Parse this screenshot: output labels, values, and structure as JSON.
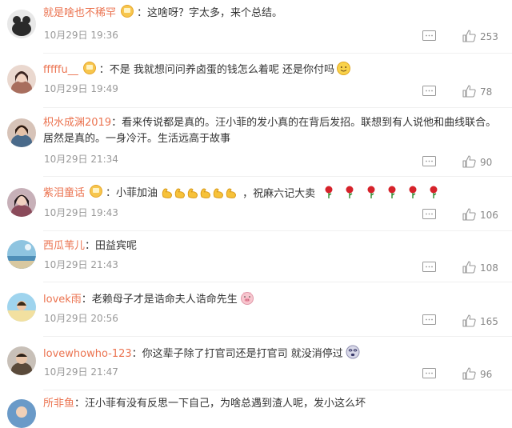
{
  "comments": [
    {
      "user": "就是啥也不稀罕",
      "vip": true,
      "text": "：这啥呀？字太多，来个总结。",
      "time": "10月29日 19:36",
      "likes": "253",
      "avatar_color": "#2a2a2a",
      "emoji": ""
    },
    {
      "user": "fffffu__",
      "vip": true,
      "text": "：不是 我就想问问养卤蛋的钱怎么着呢 还是你付吗",
      "time": "10月29日 19:49",
      "likes": "78",
      "avatar_color": "#c89a88",
      "emoji": "smile"
    },
    {
      "user": "枳水成渊2019",
      "vip": false,
      "text": "：看来传说都是真的。汪小菲的发小真的在背后发招。联想到有人说他和曲线联合。居然是真的。一身冷汗。生活远高于故事",
      "time": "10月29日 21:34",
      "likes": "90",
      "avatar_color": "#5a3a2e",
      "emoji": ""
    },
    {
      "user": "紫泪童话",
      "vip": true,
      "text": "：小菲加油",
      "time": "10月29日 19:43",
      "likes": "106",
      "avatar_color": "#8a4a5a",
      "emoji": "strong-roses"
    },
    {
      "user": "西瓜苇儿",
      "vip": false,
      "text": "：田益宾呢",
      "time": "10月29日 21:43",
      "likes": "108",
      "avatar_color": "#6aa8c8",
      "emoji": ""
    },
    {
      "user": "lovek雨",
      "vip": false,
      "text": "：老赖母子才是诰命夫人诰命先生",
      "time": "10月29日 20:56",
      "likes": "165",
      "avatar_color": "#78b8d8",
      "emoji": "pig"
    },
    {
      "user": "lovewhowho-123",
      "vip": false,
      "text": "：你这辈子除了打官司还是打官司 就没消停过",
      "time": "10月29日 21:47",
      "likes": "96",
      "avatar_color": "#7a6a5a",
      "emoji": "dizzy"
    },
    {
      "user": "所非鱼",
      "vip": false,
      "text": "：汪小菲有没有反思一下自己，为啥总遇到渣人呢，发小这么坏",
      "time": "",
      "likes": "",
      "avatar_color": "#4a7aa8",
      "emoji": ""
    }
  ],
  "icons": {
    "reply": "reply-icon",
    "like": "thumbs-up-icon",
    "vip": "vip-badge-icon"
  },
  "colors": {
    "username": "#eb7350",
    "meta": "#999999"
  }
}
